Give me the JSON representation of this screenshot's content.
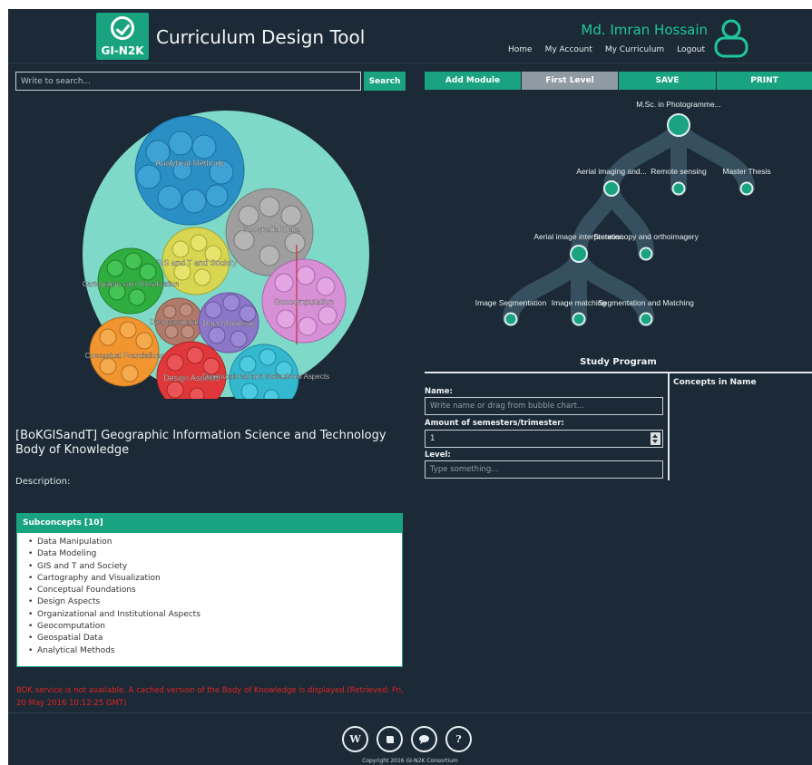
{
  "header": {
    "logo_text": "GI-N2K",
    "title": "Curriculum Design Tool",
    "user_name": "Md. Imran Hossain",
    "nav": [
      "Home",
      "My Account",
      "My Curriculum",
      "Logout"
    ]
  },
  "search": {
    "placeholder": "Write to search...",
    "button": "Search"
  },
  "bubble_chart": {
    "bubbles": [
      {
        "label": "Analytical Methods",
        "color": "#2a8fc4"
      },
      {
        "label": "Geospatial Data",
        "color": "#9e9e9e"
      },
      {
        "label": "GIS and T and Society",
        "color": "#d8d650"
      },
      {
        "label": "Cartography and Visualization",
        "color": "#2fae3f"
      },
      {
        "label": "Data Manipulation",
        "color": "#b07a6a"
      },
      {
        "label": "Data Modeling",
        "color": "#8b76c8"
      },
      {
        "label": "Geocomputation",
        "color": "#d78fd6"
      },
      {
        "label": "Conceptual Foundations",
        "color": "#f0952f"
      },
      {
        "label": "Design Aspects",
        "color": "#e0383a"
      },
      {
        "label": "Organizational and Institutional Aspects",
        "color": "#34b8cf"
      }
    ],
    "background": "#7fd9c8"
  },
  "topic": {
    "title": "[BoKGISandT] Geographic Information Science and Technology Body of Knowledge",
    "description_label": "Description:"
  },
  "subconcepts": {
    "header": "Subconcepts [10]",
    "items": [
      "Data Manipulation",
      "Data Modeling",
      "GIS and T and Society",
      "Cartography and Visualization",
      "Conceptual Foundations",
      "Design Aspects",
      "Organizational and Institutional Aspects",
      "Geocomputation",
      "Geospatial Data",
      "Analytical Methods"
    ]
  },
  "warning": "BOK service is not available. A cached version of the Body of Knowledge is displayed.(Retrieved: Fri, 20 May 2016 10:12:25 GMT)",
  "toolbar": {
    "add_module": "Add Module",
    "first_level": "First Level",
    "save": "SAVE",
    "print": "PRINT"
  },
  "tree": {
    "root": "M.Sc. in Photogramme...",
    "level1": [
      "Aerial imaging and...",
      "Remote sensing",
      "Master Thesis"
    ],
    "level2": [
      "Aerial image interpretation",
      "Stereoscopy and orthoimagery"
    ],
    "level3": [
      "Image Segmentation",
      "Image matching",
      "Segmentation and Matching"
    ]
  },
  "study_program": {
    "title": "Study Program",
    "concepts_title": "Concepts in Name",
    "name_label": "Name:",
    "name_placeholder": "Write name or drag from bubble chart...",
    "semesters_label": "Amount of semesters/trimester:",
    "semesters_value": "1",
    "level_label": "Level:",
    "level_placeholder": "Type something..."
  },
  "footer": {
    "icons": [
      "W",
      "",
      "",
      "?"
    ],
    "copyright": "Copyright 2016 GI-N2K Consortium"
  },
  "colors": {
    "background": "#1b2a36",
    "accent": "#1aa381",
    "accent_name": "#1fc79e",
    "inactive": "#8f9aa3"
  }
}
